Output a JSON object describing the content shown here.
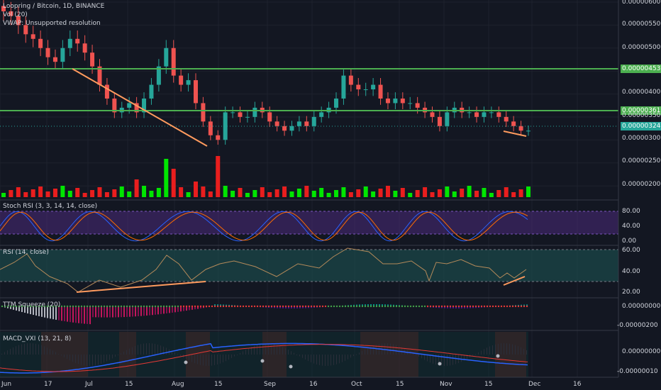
{
  "header": {
    "symbol_line": "Loopring / Bitcoin, 1D, BINANCE",
    "vol_line": "Vol (20)",
    "vwap_line": "VWAP: Unsupported resolution"
  },
  "panes": {
    "stoch_title": "Stoch RSI (3, 3, 14, 14, close)",
    "rsi_title": "RSI (14, close)",
    "ttm_title": "TTM Squeeze (20)",
    "macd_title": "MACD_VXI (13, 21, 8)"
  },
  "price_axis": [
    "0.00000600",
    "0.00000550",
    "0.00000500",
    "0.00000450",
    "0.00000400",
    "0.00000350",
    "0.00000300",
    "0.00000250",
    "0.00000200"
  ],
  "price_tags": {
    "upper_line": "0.00000453",
    "lower_line": "0.00000361",
    "last_price": "0.00000324",
    "clipped": "0.00000350"
  },
  "stoch_axis": [
    "80.00",
    "40.00",
    "0.00"
  ],
  "rsi_axis": [
    "60.00",
    "40.00",
    "20.00"
  ],
  "ttm_axis": [
    "0.00000000",
    "-0.00000200"
  ],
  "macd_axis": [
    "0.00000000",
    "-0.00000010"
  ],
  "time_axis": [
    "Jun",
    "17",
    "Jul",
    "15",
    "Aug",
    "15",
    "Sep",
    "16",
    "Oct",
    "15",
    "Nov",
    "15",
    "Dec",
    "16"
  ],
  "colors": {
    "background": "#131722",
    "up": "#26a69a",
    "down": "#ef5350",
    "vol_up": "#00e600",
    "vol_down": "#e91e1e",
    "hline": "#4caf50",
    "trend": "#ff9b5e",
    "stoch_band": "#4a2a7a",
    "rsi_band": "#1b4a4a"
  },
  "chart_data": {
    "type": "candlestick",
    "x_range": [
      "2019-06-01",
      "2019-12-20"
    ],
    "ylim": [
      1.8e-06,
      6.2e-06
    ],
    "horizontal_levels": [
      4.53e-06,
      3.61e-06
    ],
    "last_price": 3.24e-06,
    "close_series": [
      5.8e-06,
      5.7e-06,
      5.5e-06,
      5.3e-06,
      5.2e-06,
      5e-06,
      4.8e-06,
      4.7e-06,
      5e-06,
      5.2e-06,
      5.1e-06,
      4.9e-06,
      4.6e-06,
      4.2e-06,
      3.9e-06,
      3.6e-06,
      3.7e-06,
      3.8e-06,
      3.6e-06,
      3.9e-06,
      4.2e-06,
      4.6e-06,
      5e-06,
      4.4e-06,
      4.2e-06,
      4.3e-06,
      3.8e-06,
      3.4e-06,
      3.1e-06,
      3e-06,
      3.6e-06,
      3.6e-06,
      3.5e-06,
      3.5e-06,
      3.7e-06,
      3.6e-06,
      3.4e-06,
      3.3e-06,
      3.2e-06,
      3.3e-06,
      3.4e-06,
      3.3e-06,
      3.5e-06,
      3.6e-06,
      3.7e-06,
      3.9e-06,
      4.4e-06,
      4.2e-06,
      4.1e-06,
      4.1e-06,
      4.2e-06,
      3.9e-06,
      3.8e-06,
      3.9e-06,
      3.8e-06,
      3.8e-06,
      3.7e-06,
      3.6e-06,
      3.5e-06,
      3.3e-06,
      3.6e-06,
      3.7e-06,
      3.6e-06,
      3.6e-06,
      3.5e-06,
      3.6e-06,
      3.6e-06,
      3.5e-06,
      3.4e-06,
      3.3e-06,
      3.2e-06,
      3.2e-06
    ]
  }
}
